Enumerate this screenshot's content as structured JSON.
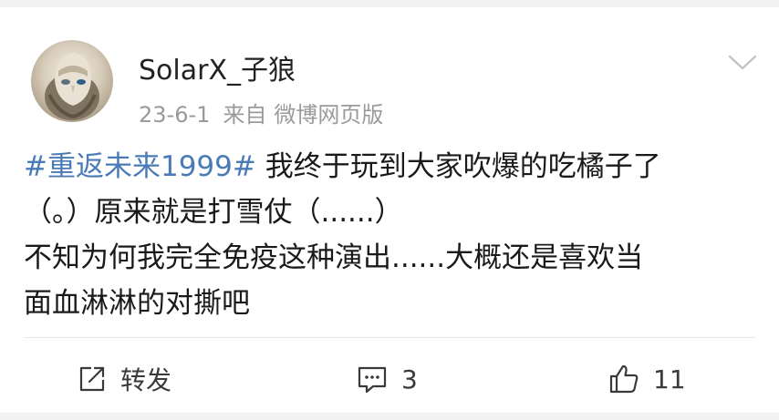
{
  "post": {
    "author": "SolarX_子狼",
    "date": "23-6-1",
    "source_label": "来自",
    "source": "微博网页版",
    "hashtag": "#重返未来1999#",
    "text_line1": " 我终于玩到大家吹爆的吃橘子了",
    "text_line2": "（。）原来就是打雪仗（......）",
    "text_line3": "不知为何我完全免疫这种演出......大概还是喜欢当",
    "text_line4": "面血淋淋的对撕吧"
  },
  "actions": {
    "repost_label": "转发",
    "comment_count": "3",
    "like_count": "11"
  },
  "icons": {
    "avatar": "avatar-image",
    "menu": "chevron-down-icon",
    "repost": "share-icon",
    "comment": "comment-icon",
    "like": "thumbs-up-icon"
  },
  "colors": {
    "hashtag": "#4a7bb7",
    "meta_text": "#9a9a9a",
    "background": "#f2f2f2"
  }
}
